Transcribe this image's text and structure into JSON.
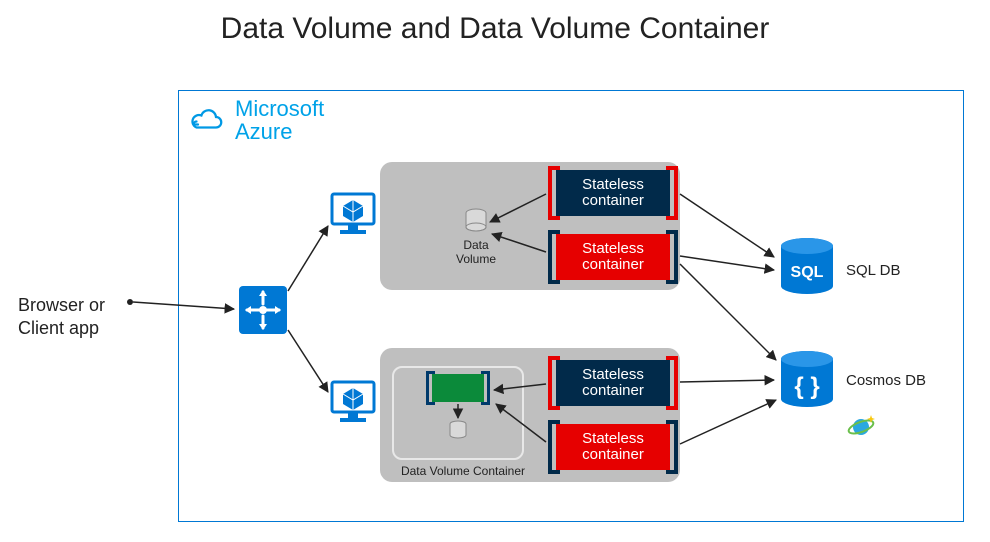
{
  "title": "Data Volume and Data Volume Container",
  "client_label_line1": "Browser or",
  "client_label_line2": "Client app",
  "azure_brand_line1": "Microsoft",
  "azure_brand_line2": "Azure",
  "data_volume_label_line1": "Data",
  "data_volume_label_line2": "Volume",
  "dvc_label": "Data Volume  Container",
  "containers": {
    "top_navy": "Stateless container",
    "top_red": "Stateless container",
    "bottom_navy": "Stateless container",
    "bottom_red": "Stateless container"
  },
  "sql_badge": "SQL",
  "sql_label": "SQL DB",
  "cosmos_badge": "{ }",
  "cosmos_label": "Cosmos DB",
  "colors": {
    "azure_blue": "#0078d4",
    "navy": "#012a4a",
    "red": "#e60000",
    "green": "#0b8a3a",
    "grey_panel": "#bfbfbf"
  }
}
